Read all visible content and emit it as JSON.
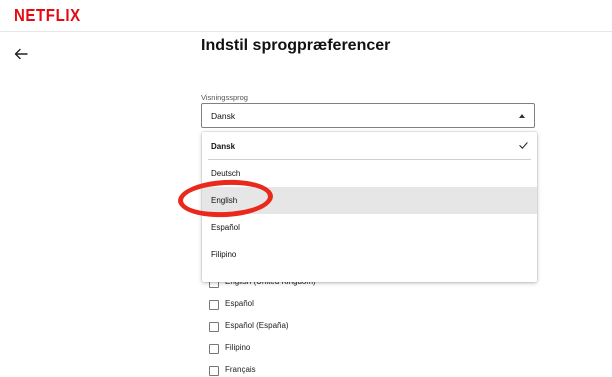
{
  "header": {
    "logo": "NETFLIX",
    "brand_color": "#e50914"
  },
  "nav": {
    "back_icon": "arrow-left-icon"
  },
  "page": {
    "title": "Indstil sprogpræferencer"
  },
  "display_language": {
    "label": "Visningssprog",
    "selected": "Dansk",
    "options": [
      {
        "label": "Dansk",
        "selected": true
      },
      {
        "label": "Deutsch",
        "selected": false
      },
      {
        "label": "English",
        "selected": false,
        "highlighted": true
      },
      {
        "label": "Español",
        "selected": false
      },
      {
        "label": "Filipino",
        "selected": false
      }
    ]
  },
  "content_languages": [
    {
      "label": "English (United Kingdom)",
      "checked": false
    },
    {
      "label": "Español",
      "checked": false
    },
    {
      "label": "Español (España)",
      "checked": false
    },
    {
      "label": "Filipino",
      "checked": false
    },
    {
      "label": "Français",
      "checked": false
    }
  ],
  "annotation": {
    "color": "#e8291c",
    "target": "English"
  }
}
